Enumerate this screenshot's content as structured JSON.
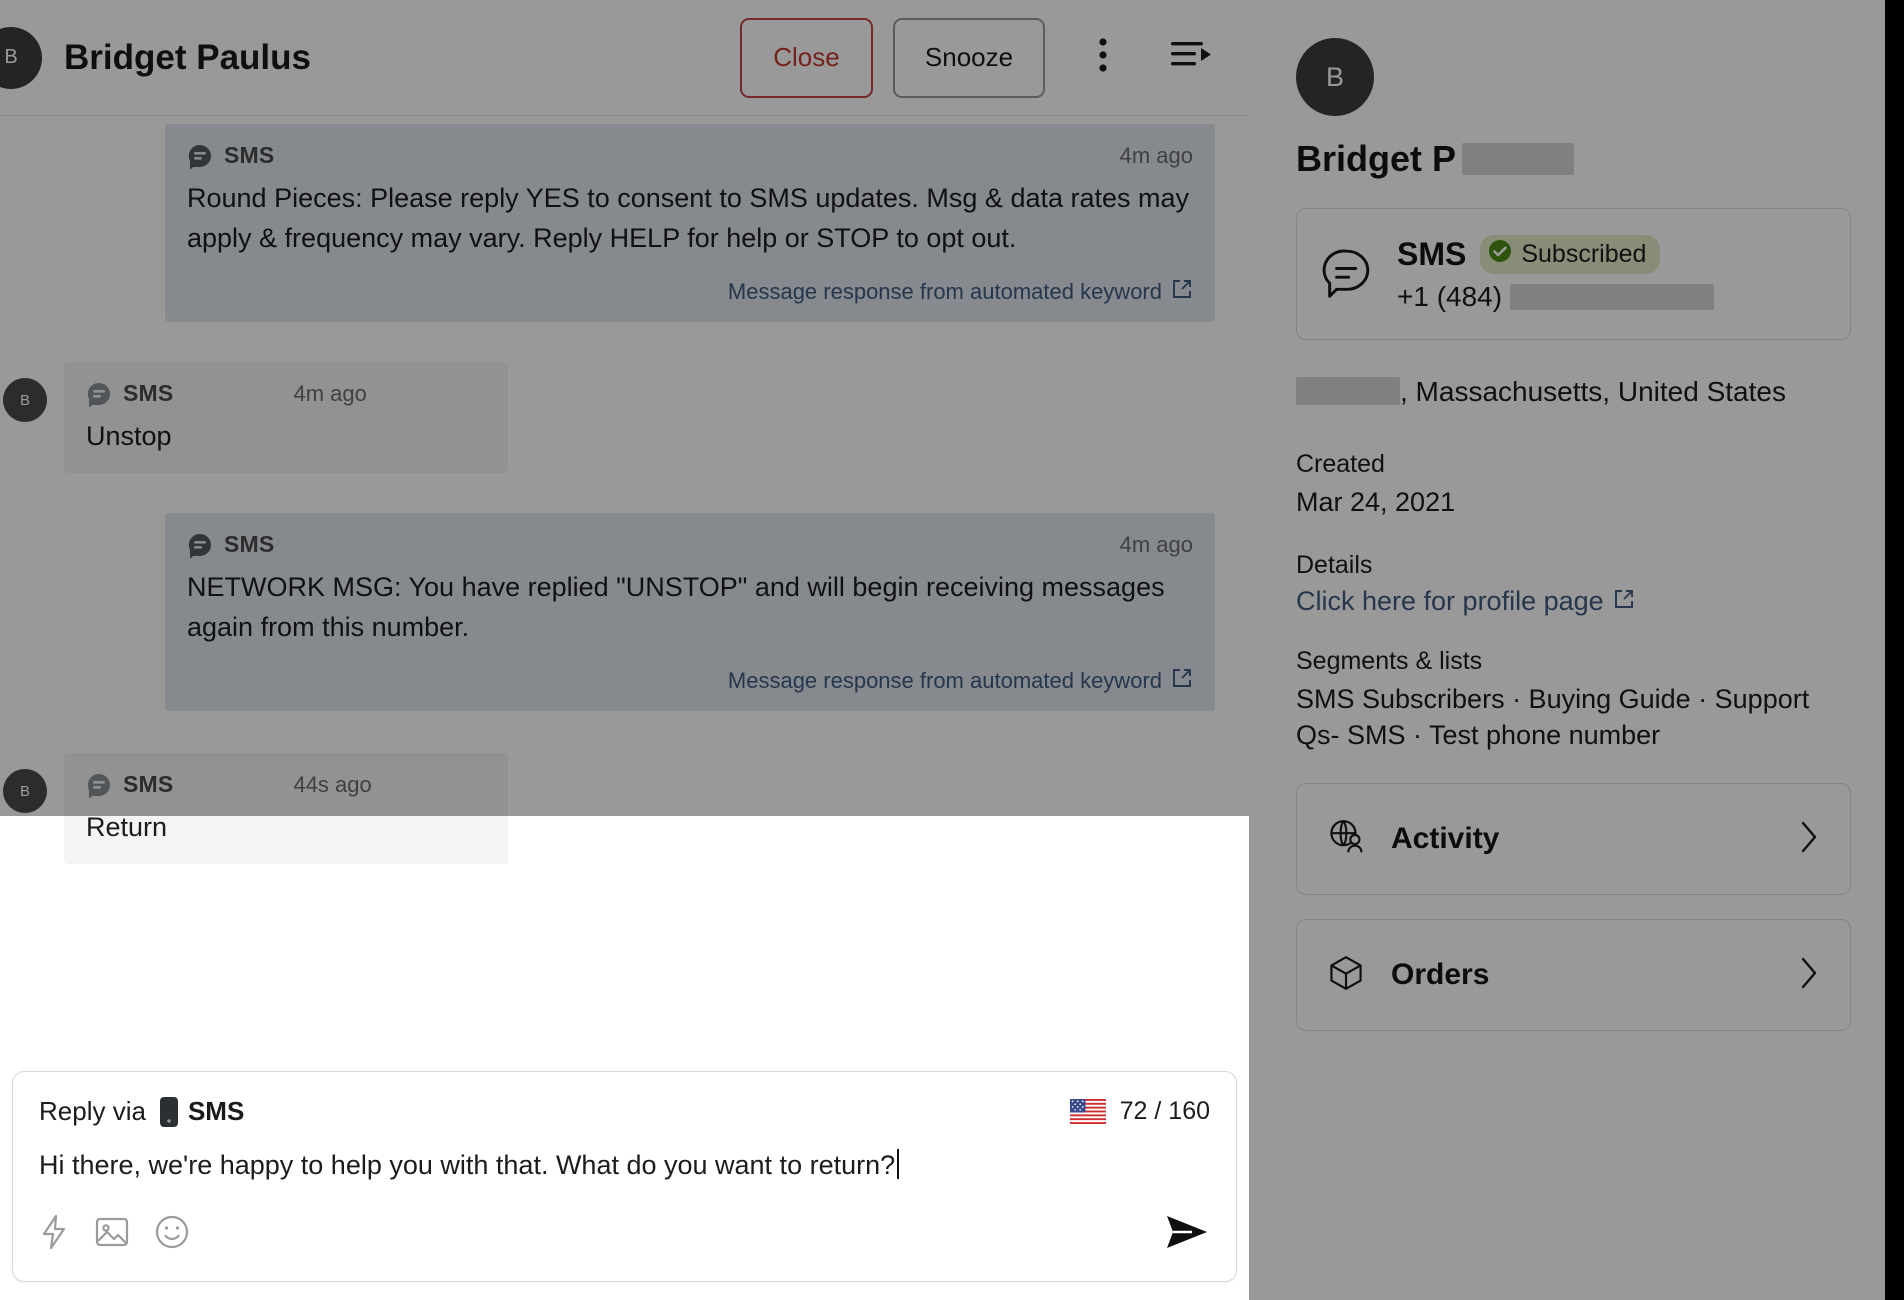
{
  "header": {
    "avatar_initial": "B",
    "title": "Bridget Paulus",
    "close_label": "Close",
    "snooze_label": "Snooze",
    "more_icon": "kebab-menu-icon",
    "queue_icon": "move-to-queue-icon"
  },
  "messages": [
    {
      "direction": "outbound",
      "channel": "SMS",
      "time": "4m ago",
      "body": "Round Pieces: Please reply YES to consent to SMS updates. Msg & data rates may apply & frequency may vary. Reply HELP for help or STOP to opt out.",
      "footnote": "Message response from automated keyword"
    },
    {
      "direction": "inbound",
      "avatar_initial": "B",
      "channel": "SMS",
      "time": "4m ago",
      "body": "Unstop",
      "footnote": ""
    },
    {
      "direction": "outbound",
      "channel": "SMS",
      "time": "4m ago",
      "body": "NETWORK MSG: You have replied \"UNSTOP\" and will begin receiving messages again from this number.",
      "footnote": "Message response from automated keyword"
    },
    {
      "direction": "inbound",
      "avatar_initial": "B",
      "channel": "SMS",
      "time": "44s ago",
      "body": "Return",
      "footnote": ""
    }
  ],
  "composer": {
    "reply_via_label": "Reply via",
    "channel": "SMS",
    "country_flag": "us-flag-icon",
    "char_counter": "72 / 160",
    "text": "Hi there, we're happy to help you with that. What do you want to return?",
    "tools": [
      {
        "name": "quick-reply-icon"
      },
      {
        "name": "image-attach-icon"
      },
      {
        "name": "emoji-picker-icon"
      }
    ],
    "send_label": "send-icon"
  },
  "contact": {
    "avatar_initial": "B",
    "name_visible": "Bridget P",
    "channel_card": {
      "icon": "sms-bubble-icon",
      "channel": "SMS",
      "status": "Subscribed",
      "status_color": "#4b8a14",
      "phone_visible": "+1 (484)"
    },
    "location_suffix": ", Massachusetts, United States",
    "created_label": "Created",
    "created_value": "Mar 24, 2021",
    "details_label": "Details",
    "details_link": "Click here for profile page",
    "segments_label": "Segments & lists",
    "segments_value": "SMS Subscribers · Buying Guide · Support Qs- SMS · Test phone number",
    "cards": [
      {
        "label": "Activity",
        "icon": "activity-globe-person-icon"
      },
      {
        "label": "Orders",
        "icon": "orders-box-icon"
      }
    ]
  },
  "colors": {
    "accent_link": "#3f5b80",
    "close_red": "#c4392f",
    "outbound_bubble": "#dfe6ee",
    "inbound_bubble": "#f3f4f6",
    "subscribed_green": "#4b8a14"
  }
}
